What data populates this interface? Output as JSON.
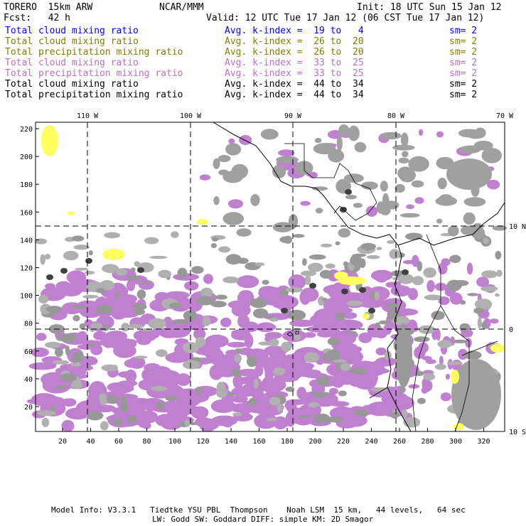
{
  "header": {
    "model": "TORERO  15km ARW",
    "org": "NCAR/MMM",
    "init": "Init: 18 UTC Sun 15 Jan 12",
    "fcst": "Fcst:   42 h",
    "valid": "Valid: 12 UTC Tue 17 Jan 12 (06 CST Tue 17 Jan 12)"
  },
  "legend": [
    {
      "field": "Total cloud mixing ratio",
      "range": "Avg. k-index =  19 to   4",
      "sm": "sm= 2",
      "color": "#0000ff"
    },
    {
      "field": "Total cloud mixing ratio",
      "range": "Avg. k-index =  26 to  20",
      "sm": "sm= 2",
      "color": "#808000"
    },
    {
      "field": "Total precipitation mixing ratio",
      "range": "Avg. k-index =  26 to  20",
      "sm": "sm= 2",
      "color": "#808000"
    },
    {
      "field": "Total cloud mixing ratio",
      "range": "Avg. k-index =  33 to  25",
      "sm": "sm= 2",
      "color": "#c070c0"
    },
    {
      "field": "Total precipitation mixing ratio",
      "range": "Avg. k-index =  33 to  25",
      "sm": "sm= 2",
      "color": "#c070c0"
    },
    {
      "field": "Total cloud mixing ratio",
      "range": "Avg. k-index =  44 to  34",
      "sm": "sm= 2",
      "color": "#000000"
    },
    {
      "field": "Total precipitation mixing ratio",
      "range": "Avg. k-index =  44 to  34",
      "sm": "sm= 2",
      "color": "#000000"
    }
  ],
  "map": {
    "lon_labels": [
      "110 W",
      "100 W",
      "90 W",
      "80 W",
      "70 W"
    ],
    "lat_labels": [
      "10 N",
      "0",
      "10 S"
    ],
    "y_ticks": [
      "220",
      "200",
      "180",
      "160",
      "140",
      "120",
      "100",
      "80",
      "60",
      "40",
      "20"
    ],
    "x_ticks": [
      "20",
      "40",
      "60",
      "80",
      "100",
      "120",
      "140",
      "160",
      "180",
      "200",
      "220",
      "240",
      "260",
      "280",
      "300",
      "320"
    ],
    "colors": {
      "gray": "#a8a8a8",
      "purple": "#c080d0",
      "yellow": "#ffff60",
      "dark": "#404040"
    }
  },
  "footer": {
    "line1": "Model Info: V3.3.1   Tiedtke YSU PBL  Thompson    Noah LSM  15 km,   44 levels,   64 sec",
    "line2": "LW: Godd SW: Goddard DIFF: simple KM: 2D Smagor"
  }
}
